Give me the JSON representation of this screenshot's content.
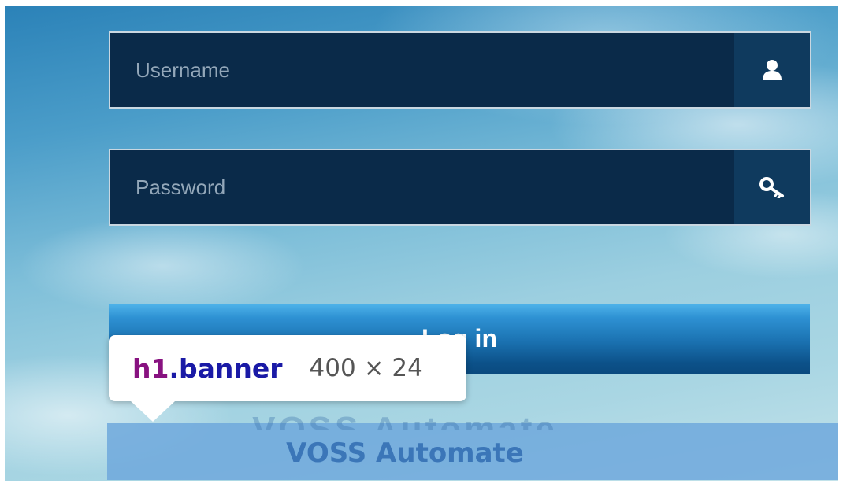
{
  "login_form": {
    "username_placeholder": "Username",
    "username_icon": "user-icon",
    "password_placeholder": "Password",
    "password_icon": "key-icon",
    "login_button_label": "Log in"
  },
  "banner": {
    "text": "VOSS Automate",
    "shadow_text": "VOSS Automate"
  },
  "devtools_tooltip": {
    "tag": "h1",
    "class_name": ".banner",
    "dimensions": "400 × 24"
  },
  "colors": {
    "field_background": "#0a2a49",
    "field_addon": "#0f3a5e",
    "button_accent": "#1a71b0",
    "banner_text": "#3b76b8",
    "highlight_overlay": "#6fa8dc"
  }
}
